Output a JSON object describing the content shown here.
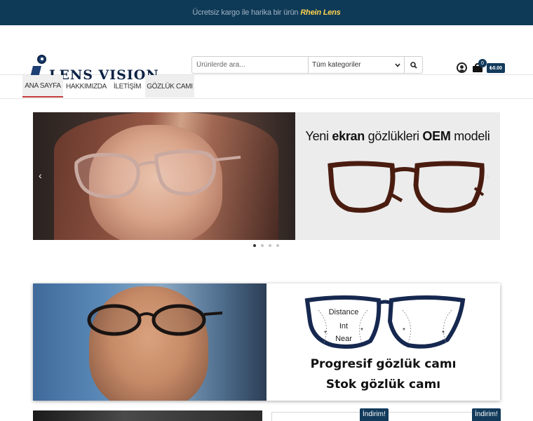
{
  "topbar": {
    "message": "Ücretsiz kargo ile harika bir ürün",
    "brand": "Rhein Lens"
  },
  "logo": {
    "text": "LENS VISION"
  },
  "search": {
    "placeholder": "Ürünlerde ara...",
    "category": "Tüm kategoriler"
  },
  "cart": {
    "count": "0",
    "total": "₺0.00"
  },
  "nav": {
    "items": [
      {
        "label": "ANA SAYFA"
      },
      {
        "label": "HAKKIMIZDA"
      },
      {
        "label": "İLETİŞİM"
      },
      {
        "label": "GÖZLÜK CAMI"
      }
    ]
  },
  "slider": {
    "title_prefix": "Yeni",
    "title_bold1": "ekran",
    "title_middle": "gözlükleri",
    "title_bold2": "OEM",
    "title_suffix": "modeli",
    "prev": "‹",
    "next": "›",
    "active_slide": 1,
    "slide_count": 4
  },
  "banner": {
    "lens_labels": {
      "distance": "Distance",
      "int": "Int",
      "near": "Near"
    },
    "line1": "Progresif gözlük camı",
    "line2": "Stok gözlük camı"
  },
  "products": {
    "badge1": "İndirim!",
    "badge2": "İndirim!"
  },
  "colors": {
    "topbar_bg": "#0f3a57",
    "brand_highlight": "#ffd34e",
    "accent_navy": "#123a5b",
    "nav_active_underline": "#c33a3a"
  }
}
